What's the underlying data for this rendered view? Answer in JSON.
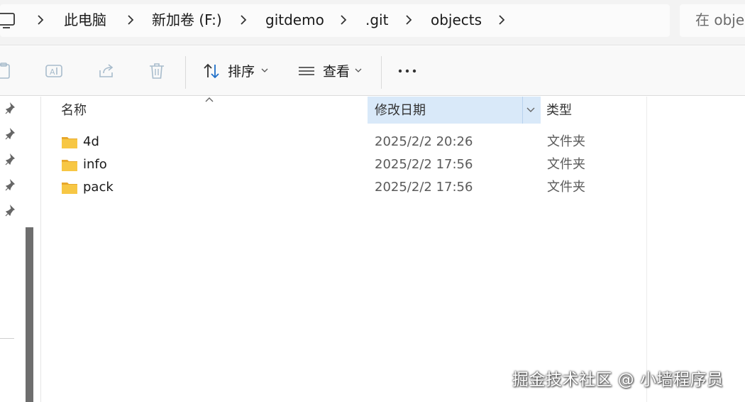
{
  "address_bar": {
    "breadcrumbs": [
      "此电脑",
      "新加卷 (F:)",
      "gitdemo",
      ".git",
      "objects"
    ],
    "search_placeholder": "在 objects 中搜索",
    "search_visible": "在 obje"
  },
  "toolbar": {
    "sort_label": "排序",
    "view_label": "查看",
    "more_label": "•••",
    "icons": [
      "paste-icon",
      "rename-icon",
      "share-icon",
      "delete-icon",
      "sort-icon",
      "view-icon",
      "more-icon"
    ]
  },
  "file_list": {
    "columns": {
      "name": "名称",
      "modified": "修改日期",
      "type": "类型"
    },
    "rows": [
      {
        "name": "4d",
        "modified": "2025/2/2 20:26",
        "type": "文件夹"
      },
      {
        "name": "info",
        "modified": "2025/2/2 17:56",
        "type": "文件夹"
      },
      {
        "name": "pack",
        "modified": "2025/2/2 17:56",
        "type": "文件夹"
      }
    ]
  },
  "watermark": "掘金技术社区 @ 小墙程序员",
  "colors": {
    "header_highlight": "#d9e9f9",
    "folder_fill": "#f7c744",
    "folder_tab": "#e8a82b",
    "toolbar_icon_disabled": "#a8bccc"
  }
}
